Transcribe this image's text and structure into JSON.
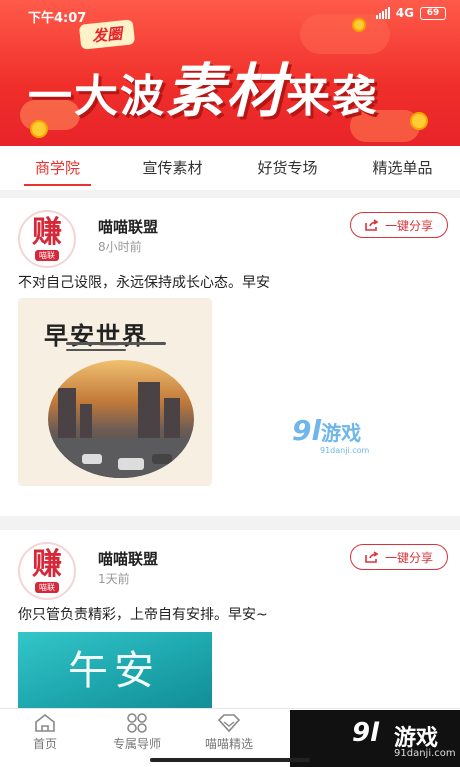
{
  "status_bar": {
    "time": "下午4:07",
    "network": "4G",
    "battery": "69"
  },
  "banner": {
    "tag": "发圈",
    "headline_part1": "一大波",
    "headline_part2": "素材",
    "headline_part3": "来袭"
  },
  "tabs": [
    {
      "label": "商学院",
      "active": true
    },
    {
      "label": "宣传素材",
      "active": false
    },
    {
      "label": "好货专场",
      "active": false
    },
    {
      "label": "精选单品",
      "active": false
    }
  ],
  "posts": [
    {
      "avatar_char": "赚",
      "avatar_sub": "喵联",
      "username": "喵喵联盟",
      "time": "8小时前",
      "share_label": "一键分享",
      "text": "不对自己设限，永远保持成长心态。早安",
      "image_title": "早安世界"
    },
    {
      "avatar_char": "赚",
      "avatar_sub": "喵联",
      "username": "喵喵联盟",
      "time": "1天前",
      "share_label": "一键分享",
      "text": "你只管负责精彩，上帝自有安排。早安~",
      "image_title": "午安"
    }
  ],
  "watermark": {
    "num": "9l",
    "text": "游戏",
    "url": "91danji.com"
  },
  "bottom_nav": [
    {
      "label": "首页",
      "icon": "home-icon"
    },
    {
      "label": "专属导师",
      "icon": "grid-icon"
    },
    {
      "label": "喵喵精选",
      "icon": "diamond-icon"
    }
  ],
  "brand_watermark": {
    "num": "9l",
    "text": "游戏",
    "url": "91danji.com"
  },
  "colors": {
    "accent": "#e8332e",
    "banner": "#ef2e2a"
  }
}
